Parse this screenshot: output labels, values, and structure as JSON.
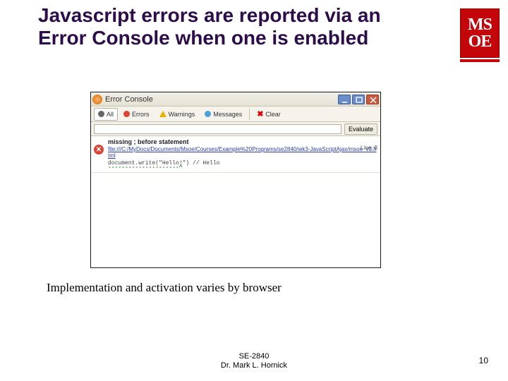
{
  "slide": {
    "title": "Javascript errors are reported via an Error Console when one is enabled",
    "subnote": "Implementation and activation varies by browser",
    "footer_course": "SE-2840",
    "footer_author": "Dr. Mark L. Hornick",
    "page_number": "10"
  },
  "logo": {
    "row1": "MS",
    "row2": "OE"
  },
  "console": {
    "window_title": "Error Console",
    "toolbar": {
      "all": "All",
      "errors": "Errors",
      "warnings": "Warnings",
      "messages": "Messages",
      "clear": "Clear"
    },
    "evaluate_btn": "Evaluate",
    "input_value": "",
    "error": {
      "message": "missing ; before statement",
      "file": "file:///C:/MyDocs/Documents/Msoe/Courses/Example%20Programs/se2840/wk3-JavaScriptAjax/msoe_v3.html",
      "line_label": "Line: 8",
      "source": "document.write(\"Hello!\") // Hello",
      "caret": "---------------------^"
    }
  }
}
